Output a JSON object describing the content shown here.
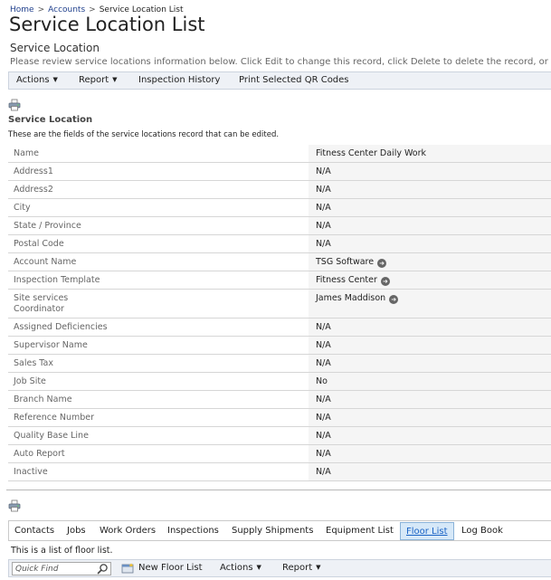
{
  "breadcrumb": {
    "home": "Home",
    "sep": ">",
    "accounts": "Accounts",
    "current": "Service Location List"
  },
  "page_title": "Service Location List",
  "section": {
    "title": "Service Location",
    "description": "Please review service locations information below. Click Edit to change this record, click Delete to delete the record, or click"
  },
  "toolbar": {
    "actions": "Actions",
    "report": "Report",
    "inspection_history": "Inspection History",
    "print_qr": "Print Selected QR Codes"
  },
  "form": {
    "title": "Service Location",
    "description": "These are the fields of the service locations record that can be edited.",
    "fields": [
      {
        "label": "Name",
        "value": "Fitness Center Daily Work"
      },
      {
        "label": "Address1",
        "value": "N/A"
      },
      {
        "label": "Address2",
        "value": "N/A"
      },
      {
        "label": "City",
        "value": "N/A"
      },
      {
        "label": "State / Province",
        "value": "N/A"
      },
      {
        "label": "Postal Code",
        "value": "N/A"
      },
      {
        "label": "Account Name",
        "value": "TSG Software",
        "link": true
      },
      {
        "label": "Inspection Template",
        "value": "Fitness Center",
        "link": true
      },
      {
        "label": "Site services Coordinator",
        "value": "James Maddison",
        "link": true
      },
      {
        "label": "Assigned Deficiencies",
        "value": "N/A"
      },
      {
        "label": "Supervisor Name",
        "value": "N/A"
      },
      {
        "label": "Sales Tax",
        "value": "N/A"
      },
      {
        "label": "Job Site",
        "value": "No"
      },
      {
        "label": "Branch Name",
        "value": "N/A"
      },
      {
        "label": "Reference Number",
        "value": "N/A"
      },
      {
        "label": "Quality Base Line",
        "value": "N/A"
      },
      {
        "label": "Auto Report",
        "value": "N/A"
      },
      {
        "label": "Inactive",
        "value": "N/A"
      }
    ]
  },
  "tabs": [
    {
      "label": "Contacts"
    },
    {
      "label": "Jobs"
    },
    {
      "label": "Work Orders"
    },
    {
      "label": "Inspections"
    },
    {
      "label": "Supply Shipments"
    },
    {
      "label": "Equipment List"
    },
    {
      "label": "Floor List",
      "active": true
    },
    {
      "label": "Log Book"
    }
  ],
  "floor_list": {
    "description": "This is a list of floor list.",
    "search_placeholder": "Quick Find",
    "new_floor_list": "New Floor List",
    "actions": "Actions",
    "report": "Report"
  },
  "icons": {
    "print": "print-icon",
    "link_arrow": "arrow-right-circle-icon",
    "search": "search-icon",
    "new": "new-record-icon",
    "caret": "caret-down-icon"
  },
  "colors": {
    "link": "#1f3f8c",
    "active_tab": "#1a63c5",
    "toolbar_bg": "#eef1f6"
  }
}
